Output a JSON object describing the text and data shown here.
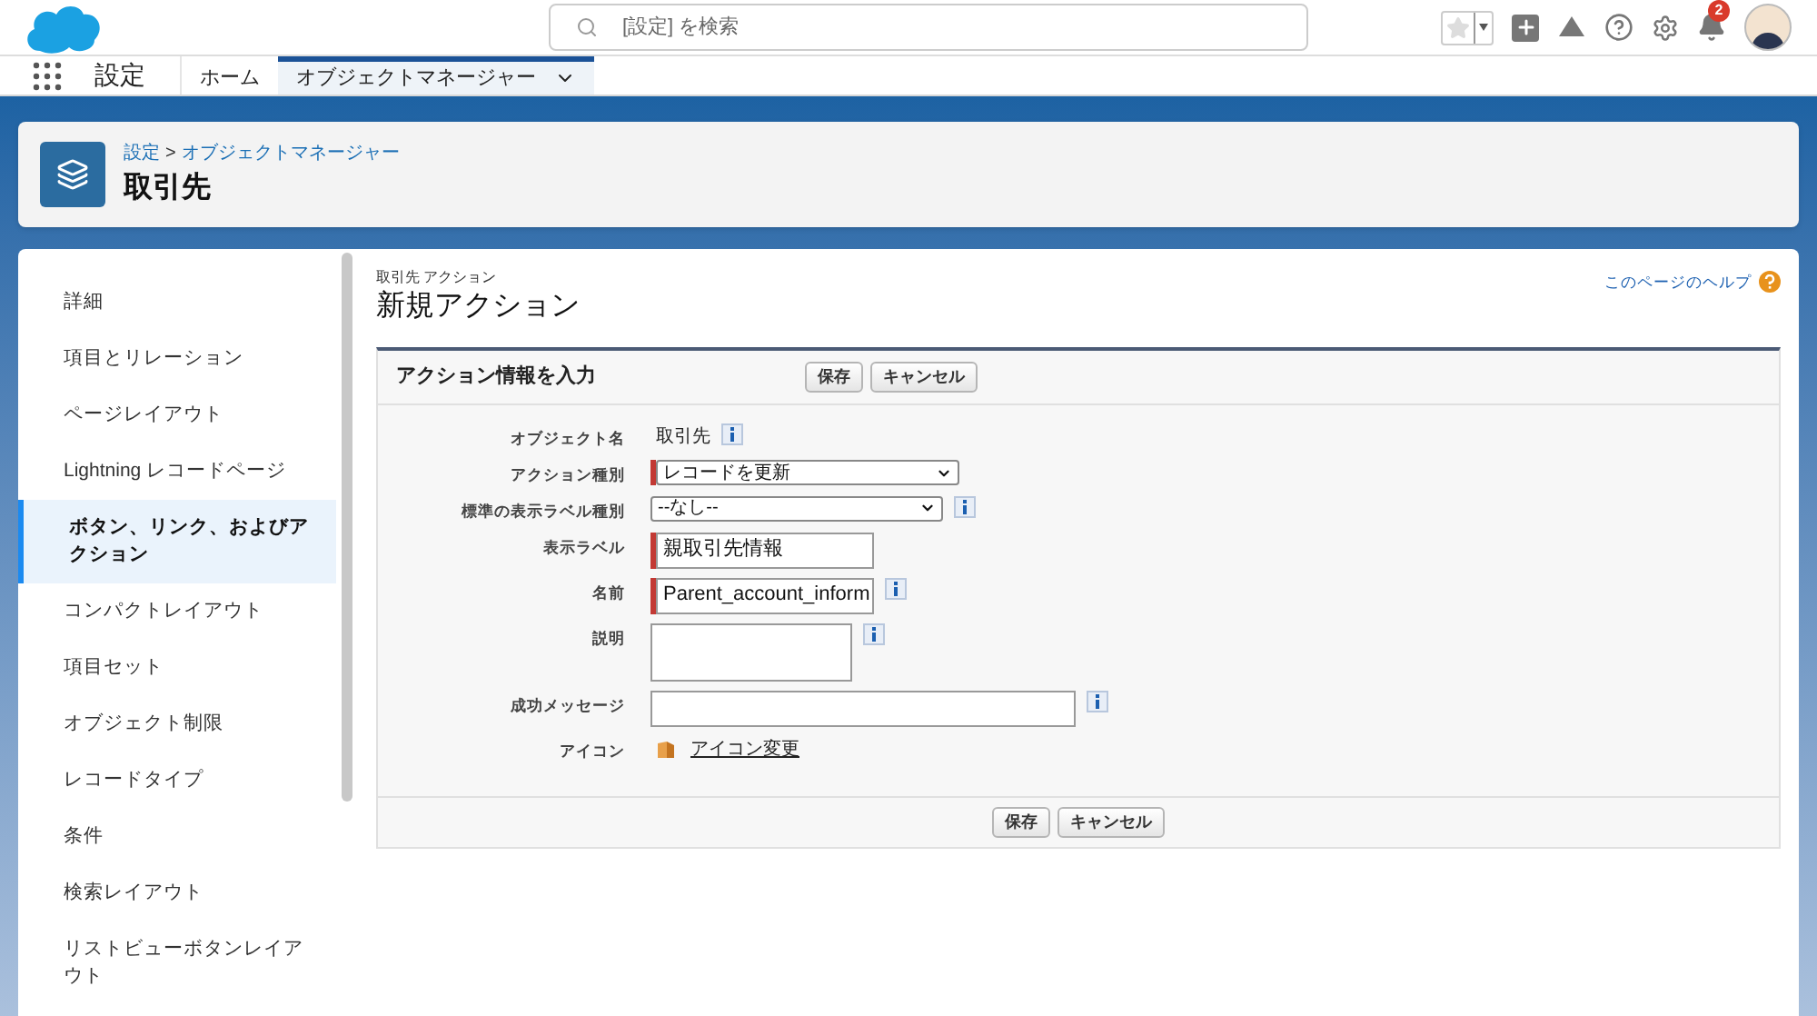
{
  "header": {
    "search": {
      "placeholder": "[設定] を検索"
    },
    "notifications": "2"
  },
  "nav": {
    "app_name": "設定",
    "tabs": [
      {
        "label": "ホーム",
        "selected": false,
        "dropdown": false
      },
      {
        "label": "オブジェクトマネージャー",
        "selected": true,
        "dropdown": true
      }
    ]
  },
  "page_header": {
    "breadcrumb": [
      {
        "label": "設定"
      },
      {
        "label": "オブジェクトマネージャー"
      }
    ],
    "separator": ">",
    "title": "取引先"
  },
  "sidebar": {
    "items": [
      {
        "label": "詳細",
        "selected": false
      },
      {
        "label": "項目とリレーション",
        "selected": false
      },
      {
        "label": "ページレイアウト",
        "selected": false
      },
      {
        "label": "Lightning レコードページ",
        "selected": false
      },
      {
        "label": "ボタン、リンク、およびアクション",
        "selected": true
      },
      {
        "label": "コンパクトレイアウト",
        "selected": false
      },
      {
        "label": "項目セット",
        "selected": false
      },
      {
        "label": "オブジェクト制限",
        "selected": false
      },
      {
        "label": "レコードタイプ",
        "selected": false
      },
      {
        "label": "条件",
        "selected": false
      },
      {
        "label": "検索レイアウト",
        "selected": false
      },
      {
        "label": "リストビューボタンレイアウト",
        "selected": false
      }
    ]
  },
  "content": {
    "subtitle": "取引先 アクション",
    "title": "新規アクション",
    "help_link": "このページのヘルプ",
    "form": {
      "title": "アクション情報を入力",
      "buttons": [
        "保存",
        "キャンセル"
      ],
      "fields": [
        {
          "kind": "text",
          "label": "オブジェクト名",
          "value": "取引先",
          "required": false,
          "info": true
        },
        {
          "kind": "select",
          "label": "アクション種別",
          "value": "レコードを更新",
          "required": true,
          "info": false
        },
        {
          "kind": "select",
          "label": "標準の表示ラベル種別",
          "value": "--なし--",
          "required": false,
          "info": true
        },
        {
          "kind": "input",
          "label": "表示ラベル",
          "value": "親取引先情報",
          "required": true,
          "info": false
        },
        {
          "kind": "input",
          "label": "名前",
          "value": "Parent_account_inform",
          "required": true,
          "info": true
        },
        {
          "kind": "textarea",
          "label": "説明",
          "required": false,
          "info": true
        },
        {
          "kind": "wide_input",
          "label": "成功メッセージ",
          "required": false,
          "info": true
        },
        {
          "kind": "icon_link",
          "label": "アイコン",
          "value": "アイコン変更",
          "required": false,
          "info": false
        }
      ],
      "footer_buttons": [
        "保存",
        "キャンセル"
      ]
    }
  }
}
